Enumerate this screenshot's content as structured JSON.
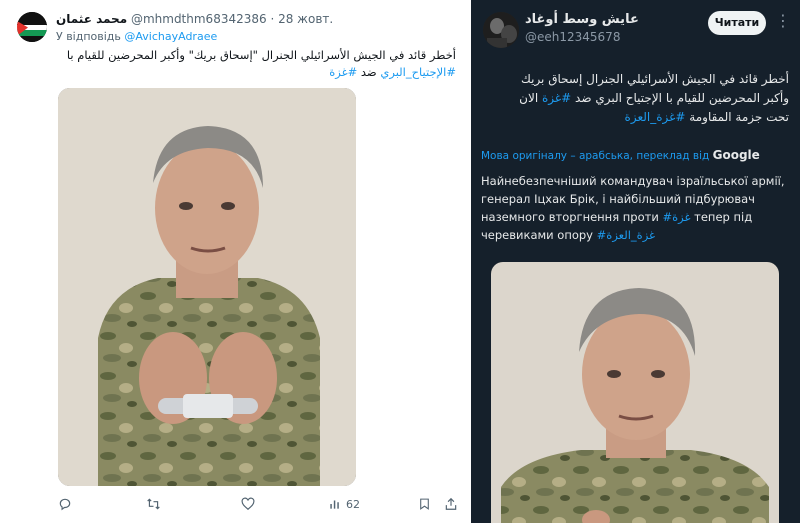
{
  "left_tweet": {
    "author_name": "محمد عثمان",
    "handle": "@mhmdthm68342386",
    "date": "· 28 жовт.",
    "reply_prefix": "У відповідь",
    "reply_mention": "@AvichayAdraee",
    "text_line1": "أخطر قائد في الجيش الأسرائيلي الجنرال \"إسحاق بريك\" وأكبر المحرضين للقيام با",
    "text_line2_hashtag": "#الإجتياح_البري",
    "text_line2_mid": " ضد ",
    "text_line2_hashtag2": "#غزة",
    "views_count": "62",
    "colors": {
      "link": "#1d9bf0",
      "muted": "#536471"
    }
  },
  "right_tweet": {
    "author_name": "عايش وسط أوغاد",
    "handle": "@eeh12345678",
    "follow_label": "Читати",
    "more_label": "⋮",
    "arabic_line1": "أخطر قائد في الجيش الأسرائيلي الجنرال إسحاق بريك",
    "arabic_line2_pre": "وأكبر المحرضين للقيام با الإجتياح البري ضد ",
    "arabic_line2_hashtag": "#غزة",
    "arabic_line2_post": " الان",
    "arabic_line3_pre": "تحت جزمة المقاومة  ",
    "arabic_line3_hashtag": "#غزة_العزة",
    "translation_note": "Мова оригіналу – арабська, переклад від",
    "translation_provider": "Google",
    "uk_line1": "Найнебезпечніший командувач ізраїльської армії,",
    "uk_line2": "генерал Іцхак Брік, і найбільший підбурювач",
    "uk_line3_pre": "наземного вторгнення проти ",
    "uk_line3_hashtag": "#غزة",
    "uk_line3_post": " тепер під",
    "uk_line4_pre": "черевиками опору ",
    "uk_line4_hashtag": "#غزة_العزة",
    "colors": {
      "background": "#15202b",
      "link": "#1d9bf0",
      "muted": "#8b98a5"
    }
  }
}
